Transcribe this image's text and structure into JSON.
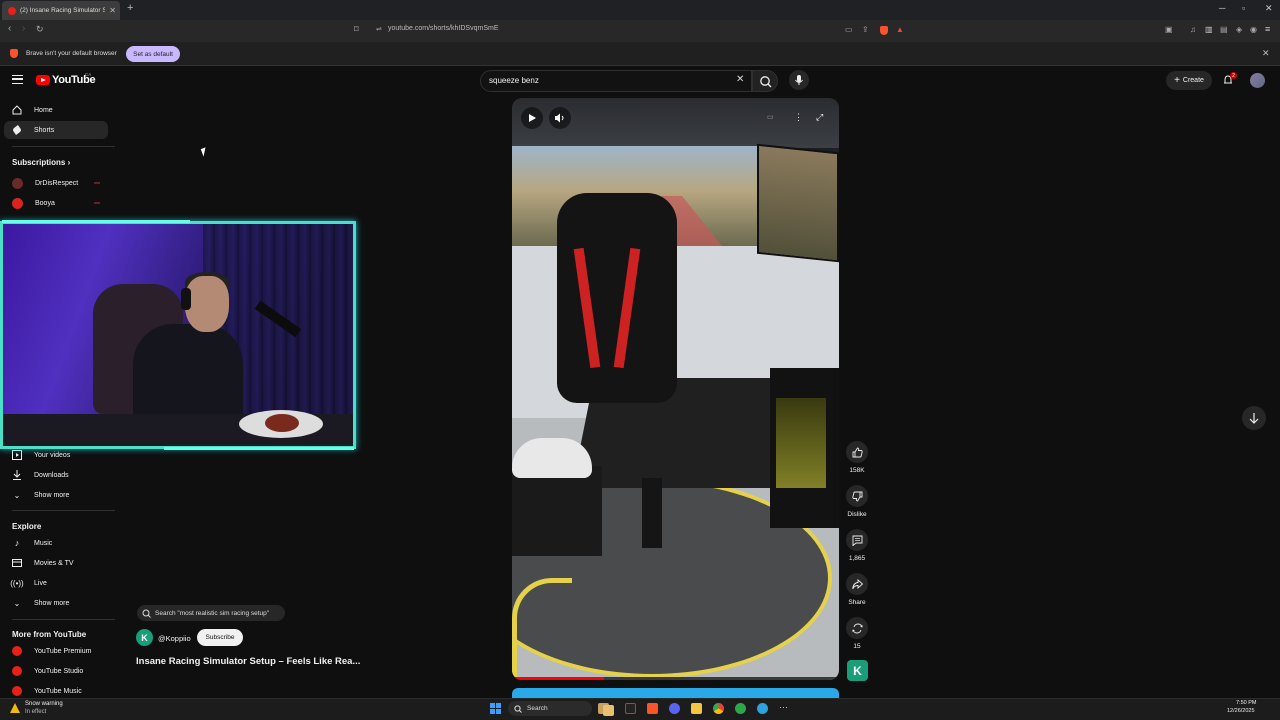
{
  "browser": {
    "tab_title": "(2) Insane Racing Simulator Setu",
    "url": "youtube.com/shorts/khIDSvqmSmE",
    "infobar_text": "Brave isn't your default browser",
    "set_default_label": "Set as default"
  },
  "header": {
    "logo_text": "YouTube",
    "country_code": "CA",
    "search_value": "squeeze benz",
    "create_label": "Create",
    "notification_count": "2"
  },
  "sidebar": {
    "home_label": "Home",
    "shorts_label": "Shorts",
    "subscriptions_heading": "Subscriptions",
    "subscriptions": [
      {
        "name": "DrDisRespect"
      },
      {
        "name": "Booya"
      }
    ],
    "your_videos_label": "Your videos",
    "downloads_label": "Downloads",
    "show_more_1": "Show more",
    "explore_heading": "Explore",
    "music_label": "Music",
    "movies_tv_label": "Movies & TV",
    "live_label": "Live",
    "show_more_2": "Show more",
    "more_from_heading": "More from YouTube",
    "yt_premium_label": "YouTube Premium",
    "yt_studio_label": "YouTube Studio",
    "yt_music_label": "YouTube Music"
  },
  "short": {
    "search_suggestion": "Search \"most realistic sim racing setup\"",
    "channel_initial": "K",
    "channel_handle": "@Koppiio",
    "subscribe_label": "Subscribe",
    "title": "Insane Racing Simulator Setup – Feels Like Rea...",
    "likes": "158K",
    "dislike_label": "Dislike",
    "comments": "1,865",
    "share_label": "Share",
    "remix_count": "15",
    "progress": 0.28
  },
  "taskbar": {
    "weather_line1": "Snow warning",
    "weather_line2": "In effect",
    "search_label": "Search",
    "time": "7:50 PM",
    "date": "12/26/2025"
  },
  "colors": {
    "accent_red": "#ff0000",
    "webcam_border": "#48e0c7",
    "brave_button": "#c9b8ff"
  }
}
